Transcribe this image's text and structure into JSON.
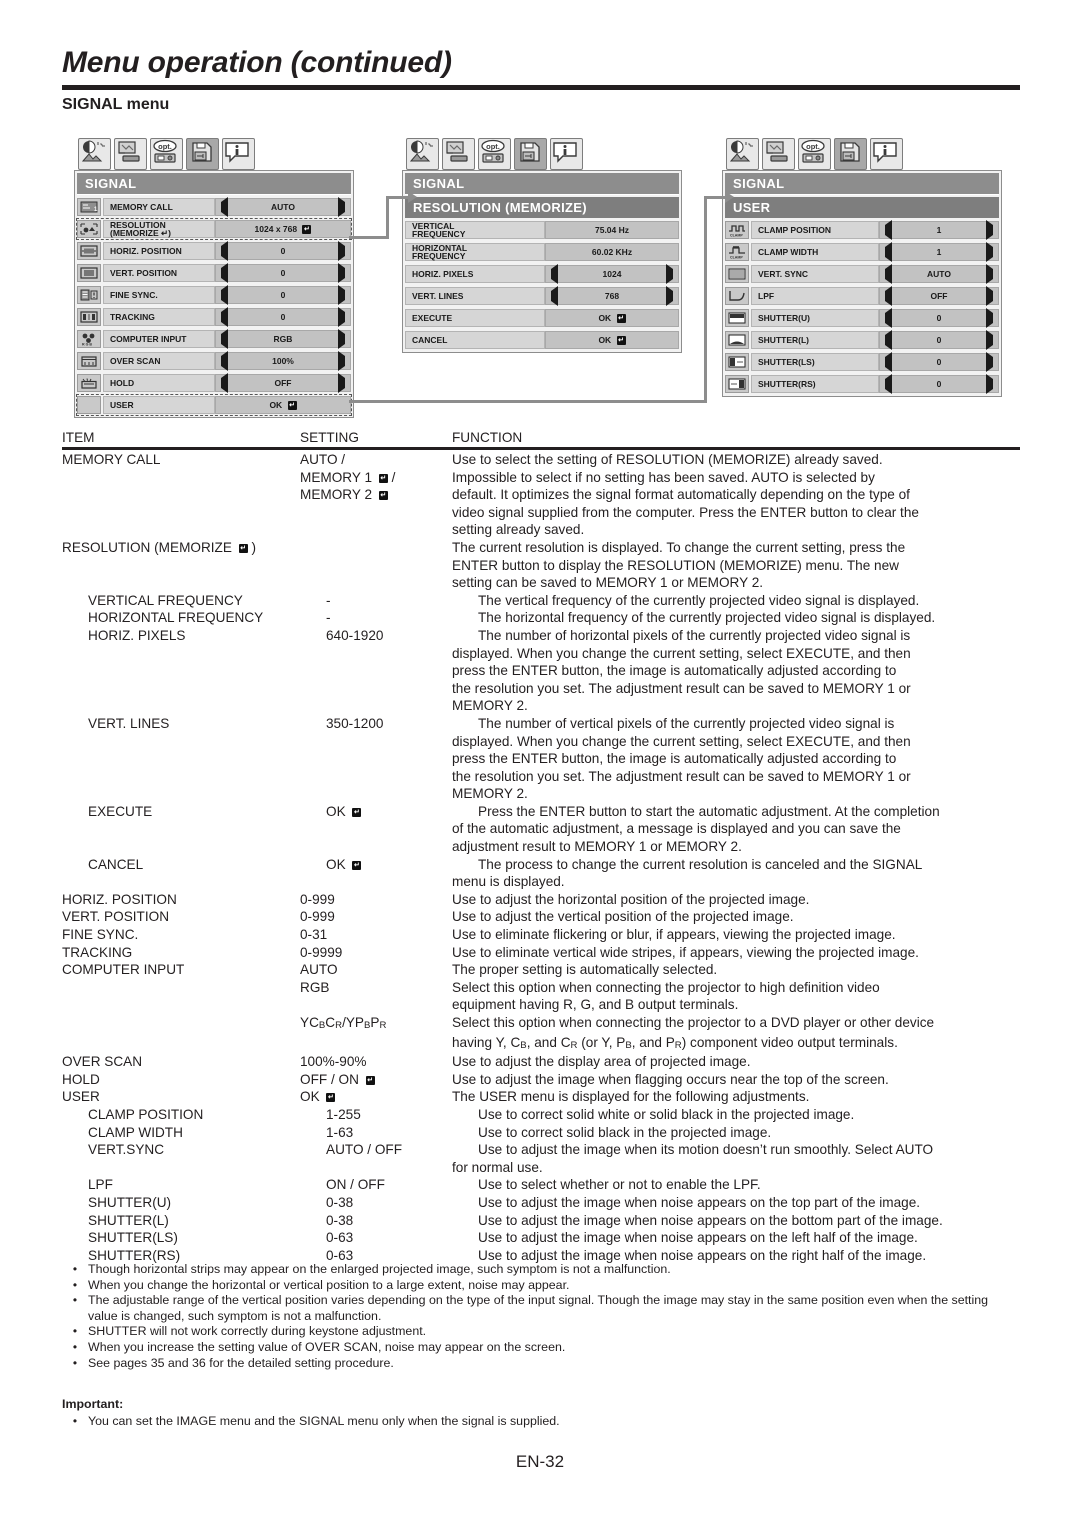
{
  "header": {
    "title": "Menu operation (continued)",
    "section": "SIGNAL menu"
  },
  "osd_panels": [
    {
      "name": "signal-main",
      "tabs": [
        "image-tab-icon",
        "installation-tab-icon",
        "option-tab-icon",
        "signal-tab-icon",
        "information-tab-icon"
      ],
      "selected_tab_index": 3,
      "title": "SIGNAL",
      "rows": [
        {
          "icon": "memory-call-icon",
          "label": "MEMORY CALL",
          "value": "AUTO",
          "arrows": true
        },
        {
          "icon": "resolution-icon",
          "label": "RESOLUTION\n(MEMORIZE ↵)",
          "value": "1024 x 768 ↵",
          "arrows": false,
          "highlight": true
        },
        {
          "icon": "horiz-position-icon",
          "label": "HORIZ. POSITION",
          "value": "0",
          "arrows": true
        },
        {
          "icon": "vert-position-icon",
          "label": "VERT. POSITION",
          "value": "0",
          "arrows": true
        },
        {
          "icon": "fine-sync-icon",
          "label": "FINE SYNC.",
          "value": "0",
          "arrows": true
        },
        {
          "icon": "tracking-icon",
          "label": "TRACKING",
          "value": "0",
          "arrows": true
        },
        {
          "icon": "computer-input-icon",
          "label": "COMPUTER INPUT",
          "value": "RGB",
          "arrows": true
        },
        {
          "icon": "over-scan-icon",
          "label": "OVER SCAN",
          "value": "100%",
          "arrows": true
        },
        {
          "icon": "hold-icon",
          "label": "HOLD",
          "value": "OFF",
          "arrows": true
        },
        {
          "icon": "",
          "label": "USER",
          "value": "OK ↵",
          "arrows": false,
          "highlight": true
        }
      ]
    },
    {
      "name": "resolution-memorize",
      "tabs": [
        "image-tab-icon",
        "installation-tab-icon",
        "option-tab-icon",
        "signal-tab-icon",
        "information-tab-icon"
      ],
      "selected_tab_index": 3,
      "title": "SIGNAL",
      "subtitle": "RESOLUTION (MEMORIZE)",
      "rows": [
        {
          "label": "VERTICAL\nFREQUENCY",
          "value": "75.04 Hz",
          "arrows": false
        },
        {
          "label": "HORIZONTAL\nFREQUENCY",
          "value": "60.02 KHz",
          "arrows": false
        },
        {
          "label": "HORIZ. PIXELS",
          "value": "1024",
          "arrows": true
        },
        {
          "label": "VERT. LINES",
          "value": "768",
          "arrows": true
        },
        {
          "label": "EXECUTE",
          "value": "OK ↵",
          "arrows": false
        },
        {
          "label": "CANCEL",
          "value": "OK ↵",
          "arrows": false
        }
      ]
    },
    {
      "name": "user-menu",
      "tabs": [
        "image-tab-icon",
        "installation-tab-icon",
        "option-tab-icon",
        "signal-tab-icon",
        "information-tab-icon"
      ],
      "selected_tab_index": 3,
      "title": "SIGNAL",
      "subtitle": "USER",
      "rows": [
        {
          "icon": "clamp-position-icon",
          "label": "CLAMP POSITION",
          "value": "1",
          "arrows": true
        },
        {
          "icon": "clamp-width-icon",
          "label": "CLAMP WIDTH",
          "value": "1",
          "arrows": true
        },
        {
          "icon": "vert-sync-icon",
          "label": "VERT. SYNC",
          "value": "AUTO",
          "arrows": true
        },
        {
          "icon": "lpf-icon",
          "label": "LPF",
          "value": "OFF",
          "arrows": true
        },
        {
          "icon": "shutter-u-icon",
          "label": "SHUTTER(U)",
          "value": "0",
          "arrows": true
        },
        {
          "icon": "shutter-l-icon",
          "label": "SHUTTER(L)",
          "value": "0",
          "arrows": true
        },
        {
          "icon": "shutter-ls-icon",
          "label": "SHUTTER(LS)",
          "value": "0",
          "arrows": true
        },
        {
          "icon": "shutter-rs-icon",
          "label": "SHUTTER(RS)",
          "value": "0",
          "arrows": true
        }
      ]
    }
  ],
  "table": {
    "headers": [
      "ITEM",
      "SETTING",
      "FUNCTION"
    ],
    "rows": [
      {
        "item": [
          "MEMORY CALL"
        ],
        "setting": [
          "AUTO /",
          "MEMORY 1 ↵ /",
          "MEMORY 2 ↵"
        ],
        "function": [
          "Use to select the setting of RESOLUTION (MEMORIZE) already saved.",
          "Impossible to select if no setting has been saved. AUTO is selected by",
          "default. It optimizes the signal format automatically depending on the type of",
          "video signal supplied from the computer. Press the ENTER button to clear the",
          "setting already saved."
        ],
        "indent": 0
      },
      {
        "item": [
          "RESOLUTION (MEMORIZE ↵ )"
        ],
        "setting": [
          ""
        ],
        "function": [
          "The current resolution is displayed. To change the current setting, press the",
          "ENTER button to display the RESOLUTION (MEMORIZE) menu. The new",
          "setting can be saved to MEMORY 1 or MEMORY 2."
        ],
        "indent": 0
      },
      {
        "item": [
          "VERTICAL FREQUENCY"
        ],
        "setting": [
          "-"
        ],
        "function": [
          "The vertical frequency of the currently projected video signal is displayed."
        ],
        "indent": 1
      },
      {
        "item": [
          "HORIZONTAL FREQUENCY"
        ],
        "setting": [
          "-"
        ],
        "function": [
          "The horizontal frequency of the currently projected video signal is displayed."
        ],
        "indent": 1
      },
      {
        "item": [
          "HORIZ. PIXELS"
        ],
        "setting": [
          "640-1920"
        ],
        "function": [
          "The number of horizontal pixels of the currently projected video signal is",
          "displayed. When you change the current setting, select EXECUTE, and then",
          "press the ENTER button, the image is automatically adjusted according to",
          "the resolution you set. The adjustment result can be saved to MEMORY 1 or",
          "MEMORY 2."
        ],
        "indent": 1
      },
      {
        "item": [
          "VERT. LINES"
        ],
        "setting": [
          "350-1200"
        ],
        "function": [
          "The number of vertical pixels of the currently projected video signal is",
          "displayed. When you change the current setting, select EXECUTE, and then",
          "press the ENTER button, the image is automatically adjusted according to",
          "the resolution you set. The adjustment result can be saved to MEMORY 1 or",
          "MEMORY 2."
        ],
        "indent": 1
      },
      {
        "item": [
          "EXECUTE"
        ],
        "setting": [
          "OK ↵"
        ],
        "function": [
          "Press the ENTER button to start the automatic adjustment. At the completion",
          "of the automatic adjustment, a message is displayed and you can save the",
          "adjustment result to MEMORY 1 or MEMORY 2."
        ],
        "indent": 1
      },
      {
        "item": [
          "CANCEL"
        ],
        "setting": [
          "OK ↵"
        ],
        "function": [
          "The process to change the current resolution is canceled and the SIGNAL",
          "menu is displayed."
        ],
        "indent": 1
      },
      {
        "item": [
          "HORIZ. POSITION"
        ],
        "setting": [
          "0-999"
        ],
        "function": [
          "Use to adjust the horizontal position of the projected image."
        ],
        "indent": 0
      },
      {
        "item": [
          "VERT. POSITION"
        ],
        "setting": [
          "0-999"
        ],
        "function": [
          "Use to adjust the vertical position of the projected image."
        ],
        "indent": 0
      },
      {
        "item": [
          "FINE SYNC."
        ],
        "setting": [
          "0-31"
        ],
        "function": [
          "Use to eliminate flickering or blur, if appears, viewing the projected image."
        ],
        "indent": 0
      },
      {
        "item": [
          "TRACKING"
        ],
        "setting": [
          "0-9999"
        ],
        "function": [
          "Use to eliminate vertical wide stripes, if appears, viewing the projected image."
        ],
        "indent": 0
      },
      {
        "item": [
          "COMPUTER INPUT"
        ],
        "setting": [
          "AUTO"
        ],
        "function": [
          "The proper setting is automatically selected."
        ],
        "indent": 0
      },
      {
        "item": [
          ""
        ],
        "setting": [
          "RGB"
        ],
        "function": [
          "Select this option when connecting the projector to high definition video",
          "equipment having R, G, and B output terminals."
        ],
        "indent": 0
      },
      {
        "item": [
          ""
        ],
        "setting_html": "YC<span class=\"sub\">B</span>C<span class=\"sub\">R</span>/YP<span class=\"sub\">B</span>P<span class=\"sub\">R</span>",
        "setting": [],
        "function_html": [
          "Select this option when connecting the projector to a DVD player or other device",
          "having Y, C<span class=\"sub\">B</span>, and C<span class=\"sub\">R</span> (or Y, P<span class=\"sub\">B</span>, and P<span class=\"sub\">R</span>) component video output terminals."
        ],
        "function": [],
        "indent": 0
      },
      {
        "item": [
          "OVER SCAN"
        ],
        "setting": [
          "100%-90%"
        ],
        "function": [
          "Use to adjust the display area of projected image."
        ],
        "indent": 0
      },
      {
        "item": [
          "HOLD"
        ],
        "setting": [
          "OFF / ON ↵"
        ],
        "function": [
          "Use to adjust the image when flagging occurs near the top of the screen."
        ],
        "indent": 0
      },
      {
        "item": [
          "USER"
        ],
        "setting": [
          "OK ↵"
        ],
        "function": [
          "The USER menu is displayed for the following adjustments."
        ],
        "indent": 0
      },
      {
        "item": [
          "CLAMP POSITION"
        ],
        "setting": [
          "1-255"
        ],
        "function": [
          "Use to correct solid white or solid black in the projected image."
        ],
        "indent": 1
      },
      {
        "item": [
          "CLAMP WIDTH"
        ],
        "setting": [
          "1-63"
        ],
        "function": [
          "Use to correct solid black in the projected image."
        ],
        "indent": 1
      },
      {
        "item": [
          "VERT.SYNC"
        ],
        "setting": [
          "AUTO / OFF"
        ],
        "function": [
          "Use to adjust the image when its motion doesn’t run smoothly. Select AUTO",
          "for normal use."
        ],
        "indent": 1
      },
      {
        "item": [
          "LPF"
        ],
        "setting": [
          "ON / OFF"
        ],
        "function": [
          "Use to select whether or not to enable the LPF."
        ],
        "indent": 1
      },
      {
        "item": [
          "SHUTTER(U)"
        ],
        "setting": [
          "0-38"
        ],
        "function": [
          "Use to adjust the image when noise appears on the top part of the image."
        ],
        "indent": 1
      },
      {
        "item": [
          "SHUTTER(L)"
        ],
        "setting": [
          "0-38"
        ],
        "function": [
          "Use to adjust the image when noise appears on the bottom part of the image."
        ],
        "indent": 1
      },
      {
        "item": [
          "SHUTTER(LS)"
        ],
        "setting": [
          "0-63"
        ],
        "function": [
          "Use to adjust the image when noise appears on the left half of the image."
        ],
        "indent": 1
      },
      {
        "item": [
          "SHUTTER(RS)"
        ],
        "setting": [
          "0-63"
        ],
        "function": [
          "Use to adjust the image when noise appears on the right half of the image."
        ],
        "indent": 1
      }
    ]
  },
  "notes": [
    "Though horizontal strips may appear on the enlarged projected image, such symptom is not a malfunction.",
    "When you change the horizontal or vertical position to a large extent, noise may appear.",
    "The adjustable range of the vertical position varies depending on the type of the input signal. Though the image may stay in the same position even when the setting value is changed, such symptom is not a malfunction.",
    "SHUTTER will not work correctly during keystone adjustment.",
    "When you increase the setting value of OVER SCAN, noise may appear on the screen.",
    "See pages 35 and 36 for the detailed setting procedure."
  ],
  "important": {
    "heading": "Important:",
    "items": [
      "You can set the IMAGE menu and the SIGNAL menu only when the signal is supplied."
    ]
  },
  "page_number": "EN-32",
  "colors": {
    "text": "#231f20",
    "osd_title_bar": "#8d8d8d",
    "osd_sub_bar": "#7e7e7e",
    "osd_row_label": "#d6d6d6",
    "osd_row_value": "#c2c2c2"
  }
}
